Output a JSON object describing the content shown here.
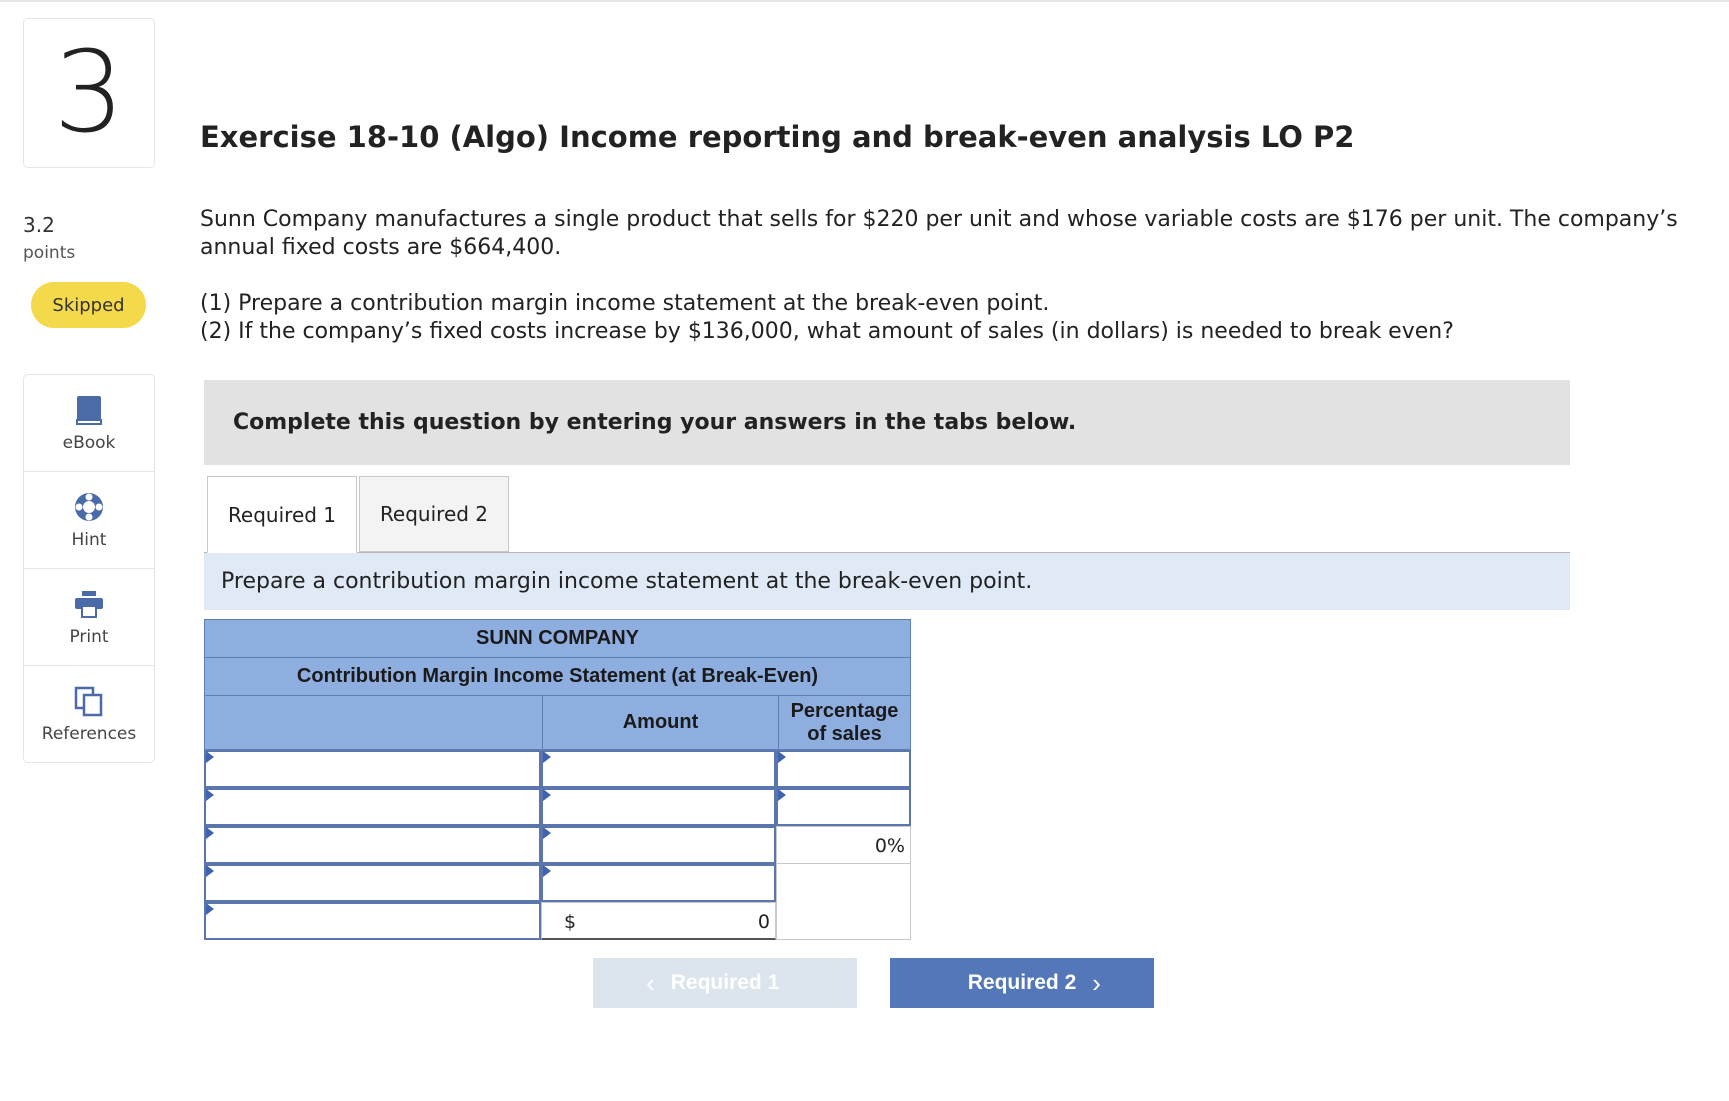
{
  "question": {
    "number": "3",
    "points_value": "3.2",
    "points_label": "points",
    "status": "Skipped",
    "title": "Exercise 18-10 (Algo) Income reporting and break-even analysis LO P2",
    "description": "Sunn Company manufactures a single product that sells for $220 per unit and whose variable costs are $176 per unit. The company’s annual fixed costs are $664,400.",
    "task_1": "(1) Prepare a contribution margin income statement at the break-even point.",
    "task_2": "(2) If the company’s fixed costs increase by $136,000, what amount of sales (in dollars) is needed to break even?"
  },
  "tools": [
    {
      "label": "eBook",
      "icon": "book-icon"
    },
    {
      "label": "Hint",
      "icon": "lifebuoy-icon"
    },
    {
      "label": "Print",
      "icon": "printer-icon"
    },
    {
      "label": "References",
      "icon": "copy-pages-icon"
    }
  ],
  "instruction": "Complete this question by entering your answers in the tabs below.",
  "tabs": [
    {
      "label": "Required 1",
      "active": true
    },
    {
      "label": "Required 2",
      "active": false
    }
  ],
  "prompt": "Prepare a contribution margin income statement at the break-even point.",
  "statement": {
    "company": "SUNN COMPANY",
    "title": "Contribution Margin Income Statement (at Break-Even)",
    "col_amount": "Amount",
    "col_pct_line1": "Percentage",
    "col_pct_line2": "of sales",
    "row3_pct": "0%",
    "total_dollar": "$",
    "total_amount": "0"
  },
  "nav": {
    "prev_label": "Required 1",
    "next_label": "Required 2"
  },
  "colors": {
    "accent": "#5477b9",
    "header_blue": "#8eaee0",
    "status_yellow": "#f4d94a",
    "prompt_bg": "#dfeaf6"
  }
}
